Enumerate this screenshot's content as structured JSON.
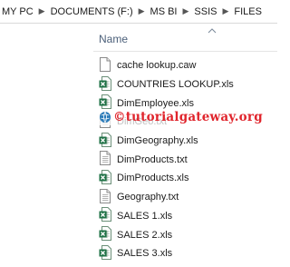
{
  "breadcrumb": [
    {
      "label": "MY PC"
    },
    {
      "label": "DOCUMENTS (F:)"
    },
    {
      "label": "MS BI"
    },
    {
      "label": "SSIS"
    },
    {
      "label": "FILES"
    }
  ],
  "column_header": {
    "label": "Name"
  },
  "watermark": {
    "text": "©tutorialgateway.org"
  },
  "files": [
    {
      "name": "cache lookup.caw",
      "type": "generic"
    },
    {
      "name": "COUNTRIES LOOKUP.xls",
      "type": "excel"
    },
    {
      "name": "DimEmployee.xls",
      "type": "excel"
    },
    {
      "name": "DimGeo.txt",
      "type": "text"
    },
    {
      "name": "DimGeography.xls",
      "type": "excel"
    },
    {
      "name": "DimProducts.txt",
      "type": "text"
    },
    {
      "name": "DimProducts.xls",
      "type": "excel"
    },
    {
      "name": "Geography.txt",
      "type": "text"
    },
    {
      "name": "SALES 1.xls",
      "type": "excel"
    },
    {
      "name": "SALES 2.xls",
      "type": "excel"
    },
    {
      "name": "SALES 3.xls",
      "type": "excel"
    }
  ],
  "colors": {
    "excel_green": "#1e7145",
    "watermark_red": "#e0242c",
    "header_text": "#4c607a"
  },
  "icons": {
    "generic": "file-icon",
    "text": "text-file-icon",
    "excel": "excel-file-icon",
    "sort": "sort-up-icon"
  }
}
